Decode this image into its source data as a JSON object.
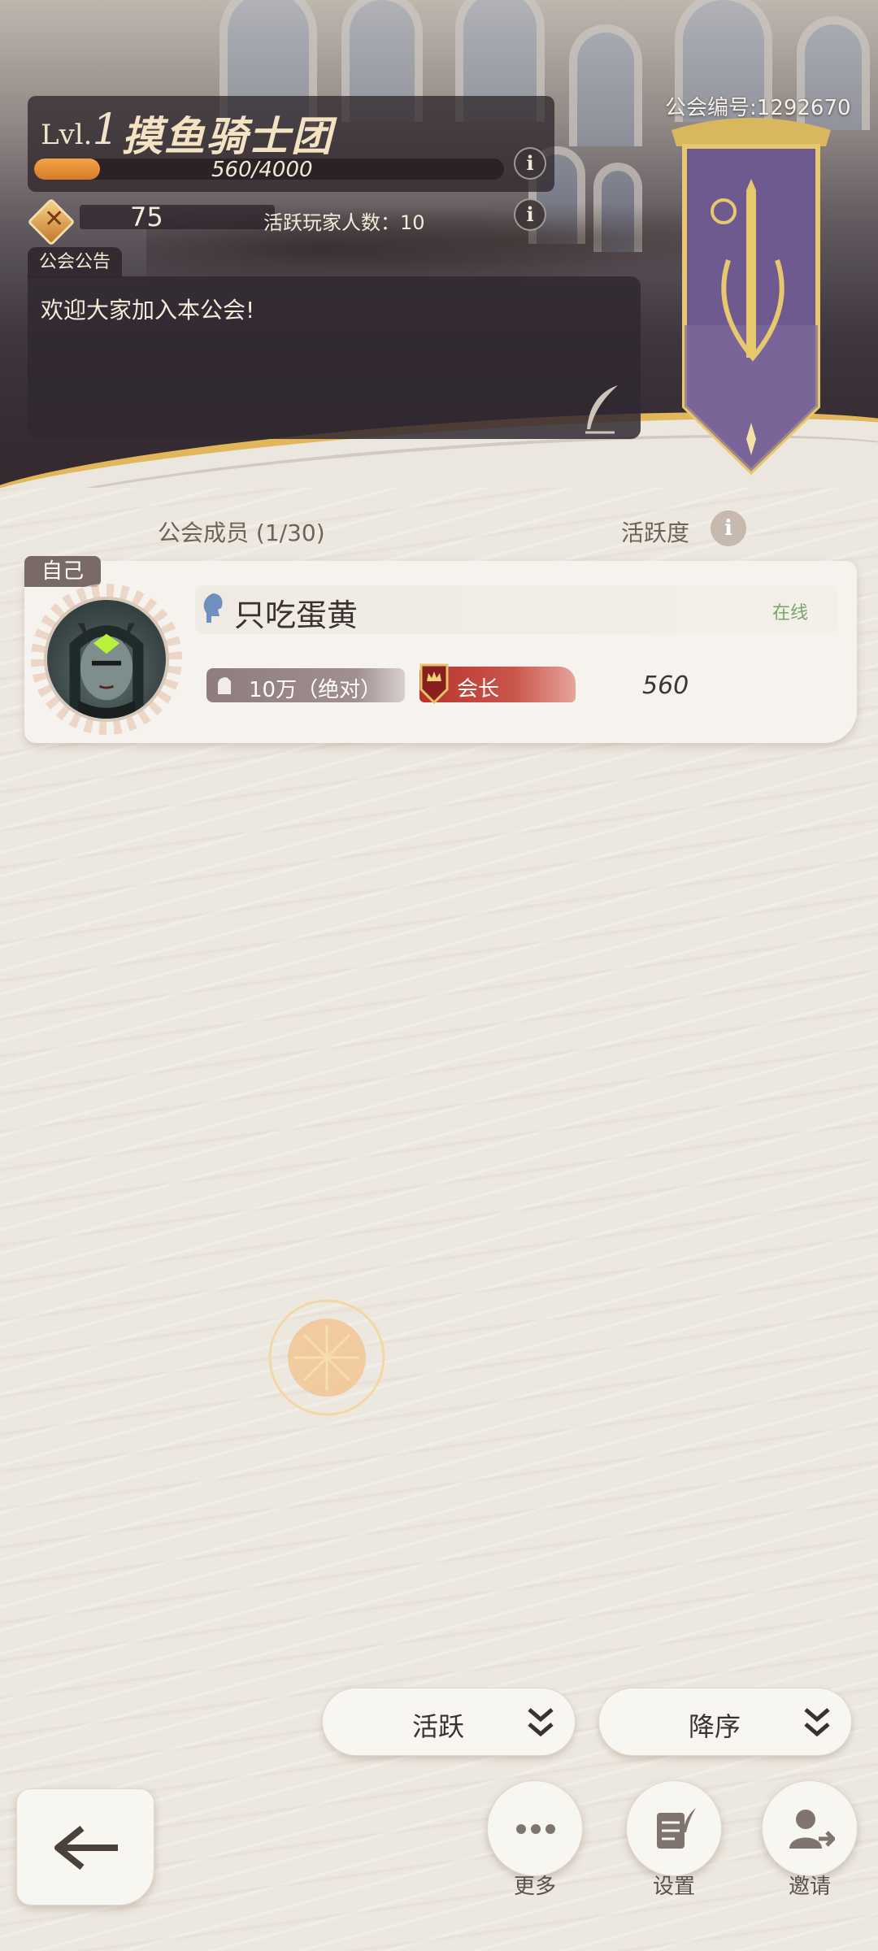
{
  "guild": {
    "level_prefix": "Lvl.",
    "level_number": "1",
    "name": "摸鱼骑士团",
    "exp_text": "560/4000",
    "exp_fraction": 0.14,
    "coin_value": "75",
    "active_players_label": "活跃玩家人数：10",
    "id_label": "公会编号:1292670"
  },
  "notice": {
    "tab_label": "公会公告",
    "text": "欢迎大家加入本公会!"
  },
  "members_section": {
    "title": "公会成员 (1/30)",
    "activity_title": "活跃度",
    "info_glyph": "i"
  },
  "member": {
    "self_tag": "自己",
    "name": "只吃蛋黄",
    "status": "在线",
    "power": "10万（绝对）",
    "role": "会长",
    "activity": "560"
  },
  "sort": {
    "field_label": "活跃",
    "order_label": "降序"
  },
  "actions": {
    "more_label": "更多",
    "settings_label": "设置",
    "invite_label": "邀请"
  },
  "colors": {
    "accent_gold": "#e2b65a",
    "exp_fill": "#f4a548",
    "online_green": "#7aa46a",
    "leader_red": "#b8342c",
    "banner_purple": "#6e5a8e"
  },
  "icons": {
    "coin": "diamond-coin-icon",
    "quill": "quill-icon",
    "gender": "female-silhouette-icon",
    "power": "fist-icon",
    "role": "crown-shield-icon",
    "back": "back-arrow-icon",
    "more": "ellipsis-icon",
    "settings": "scroll-quill-icon",
    "invite": "add-user-icon"
  }
}
